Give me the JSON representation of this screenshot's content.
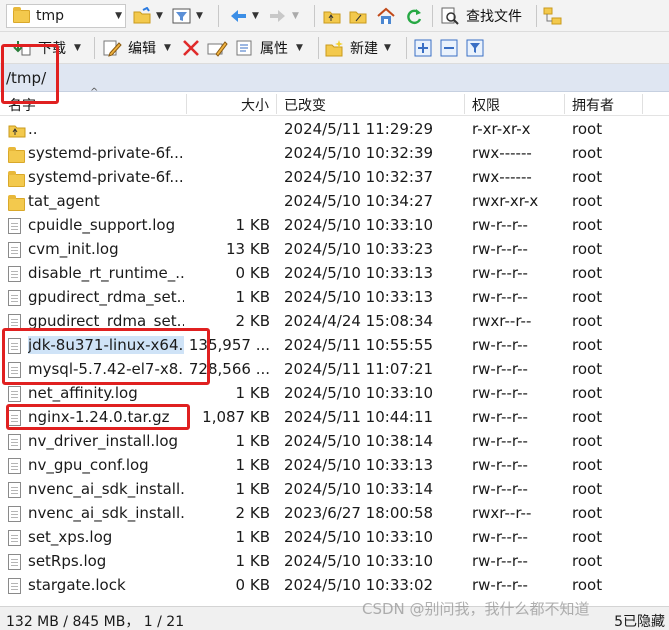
{
  "toolbar1": {
    "path_combo_value": "tmp",
    "find_files_label": "查找文件"
  },
  "toolbar2": {
    "download_label": "下载",
    "edit_label": "编辑",
    "properties_label": "属性",
    "new_label": "新建"
  },
  "pathbar": {
    "path": "/tmp/"
  },
  "columns": {
    "name": "名字",
    "size": "大小",
    "modified": "已改变",
    "permissions": "权限",
    "owner": "拥有者"
  },
  "files": [
    {
      "type": "parent",
      "name": "..",
      "size": "",
      "modified": "2024/5/11 11:29:29",
      "permissions": "r-xr-xr-x",
      "owner": "root"
    },
    {
      "type": "folder",
      "name": "systemd-private-6f...",
      "size": "",
      "modified": "2024/5/10 10:32:39",
      "permissions": "rwx------",
      "owner": "root"
    },
    {
      "type": "folder",
      "name": "systemd-private-6f...",
      "size": "",
      "modified": "2024/5/10 10:32:37",
      "permissions": "rwx------",
      "owner": "root"
    },
    {
      "type": "folder",
      "name": "tat_agent",
      "size": "",
      "modified": "2024/5/10 10:34:27",
      "permissions": "rwxr-xr-x",
      "owner": "root"
    },
    {
      "type": "file",
      "name": "cpuidle_support.log",
      "size": "1 KB",
      "modified": "2024/5/10 10:33:10",
      "permissions": "rw-r--r--",
      "owner": "root"
    },
    {
      "type": "file",
      "name": "cvm_init.log",
      "size": "13 KB",
      "modified": "2024/5/10 10:33:23",
      "permissions": "rw-r--r--",
      "owner": "root"
    },
    {
      "type": "file",
      "name": "disable_rt_runtime_...",
      "size": "0 KB",
      "modified": "2024/5/10 10:33:13",
      "permissions": "rw-r--r--",
      "owner": "root"
    },
    {
      "type": "file",
      "name": "gpudirect_rdma_set...",
      "size": "1 KB",
      "modified": "2024/5/10 10:33:13",
      "permissions": "rw-r--r--",
      "owner": "root"
    },
    {
      "type": "file",
      "name": "gpudirect_rdma_set...",
      "size": "2 KB",
      "modified": "2024/4/24 15:08:34",
      "permissions": "rwxr--r--",
      "owner": "root"
    },
    {
      "type": "file",
      "name": "jdk-8u371-linux-x64...",
      "size": "135,957 ...",
      "modified": "2024/5/11 10:55:55",
      "permissions": "rw-r--r--",
      "owner": "root",
      "selected": true
    },
    {
      "type": "file",
      "name": "mysql-5.7.42-el7-x8...",
      "size": "728,566 ...",
      "modified": "2024/5/11 11:07:21",
      "permissions": "rw-r--r--",
      "owner": "root"
    },
    {
      "type": "file",
      "name": "net_affinity.log",
      "size": "1 KB",
      "modified": "2024/5/10 10:33:10",
      "permissions": "rw-r--r--",
      "owner": "root"
    },
    {
      "type": "file",
      "name": "nginx-1.24.0.tar.gz",
      "size": "1,087 KB",
      "modified": "2024/5/11 10:44:11",
      "permissions": "rw-r--r--",
      "owner": "root"
    },
    {
      "type": "file",
      "name": "nv_driver_install.log",
      "size": "1 KB",
      "modified": "2024/5/10 10:38:14",
      "permissions": "rw-r--r--",
      "owner": "root"
    },
    {
      "type": "file",
      "name": "nv_gpu_conf.log",
      "size": "1 KB",
      "modified": "2024/5/10 10:33:13",
      "permissions": "rw-r--r--",
      "owner": "root"
    },
    {
      "type": "file",
      "name": "nvenc_ai_sdk_install...",
      "size": "1 KB",
      "modified": "2024/5/10 10:33:14",
      "permissions": "rw-r--r--",
      "owner": "root"
    },
    {
      "type": "file",
      "name": "nvenc_ai_sdk_install...",
      "size": "2 KB",
      "modified": "2023/6/27 18:00:58",
      "permissions": "rwxr--r--",
      "owner": "root"
    },
    {
      "type": "file",
      "name": "set_xps.log",
      "size": "1 KB",
      "modified": "2024/5/10 10:33:10",
      "permissions": "rw-r--r--",
      "owner": "root"
    },
    {
      "type": "file",
      "name": "setRps.log",
      "size": "1 KB",
      "modified": "2024/5/10 10:33:10",
      "permissions": "rw-r--r--",
      "owner": "root"
    },
    {
      "type": "file",
      "name": "stargate.lock",
      "size": "0 KB",
      "modified": "2024/5/10 10:33:02",
      "permissions": "rw-r--r--",
      "owner": "root"
    }
  ],
  "statusbar": {
    "left": "132 MB / 845 MB， 1 / 21",
    "right": "5已隐藏"
  },
  "watermark": "CSDN @别问我，我什么都不知道"
}
